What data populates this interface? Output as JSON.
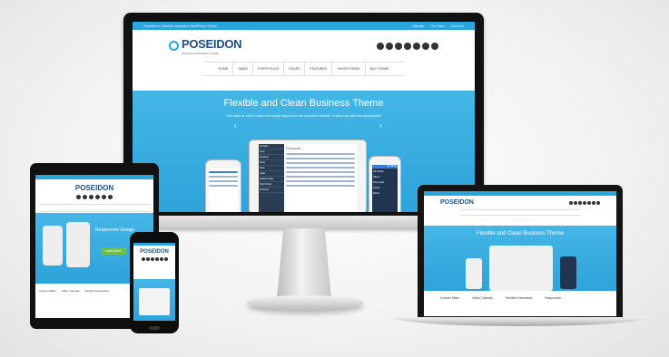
{
  "site": {
    "topbar_text": "Poseidon is a flexible responsive WordPress Theme",
    "topbar_links": [
      "Sitemap",
      "Our Team",
      "About Us"
    ],
    "logo": "POSEIDON",
    "tagline": "BUSINESS WORDPRESS THEME",
    "nav": [
      "HOME",
      "SWAG",
      "PORTFOLIOS",
      "PAGES",
      "FEATURES",
      "SHORTCODES",
      "BUY THEME"
    ],
    "hero_title": "Flexible and Clean Business Theme",
    "hero_subtitle": "This slide is set to have the image aligned to the centered bottom. It also has title and description"
  },
  "app": {
    "sidebar": [
      "All Tasks",
      "Inbox",
      "Personal",
      "Study",
      "Work",
      "Goals",
      "Kanban Today",
      "High Priority",
      "Personal"
    ],
    "header": "Personal",
    "header_right": "All Tasks",
    "phone_items": [
      "All Tasks",
      "Inbox",
      "Personal",
      "Study",
      "Work"
    ]
  },
  "tablet_site": {
    "logo": "POSEIDON",
    "hero_title": "Responsive Design",
    "button": "Learn More",
    "features": [
      "Custom Slider",
      "Video Tutorials",
      "Flexible Framework"
    ]
  },
  "laptop_site": {
    "logo": "POSEIDON",
    "hero_title": "Flexible and Clean Business Theme",
    "features": [
      "Custom Slider",
      "Video Tutorials",
      "Flexible Framework",
      "Responsive"
    ]
  },
  "colors": {
    "brand_blue": "#2aa6dd",
    "logo_navy": "#1e4f86"
  }
}
